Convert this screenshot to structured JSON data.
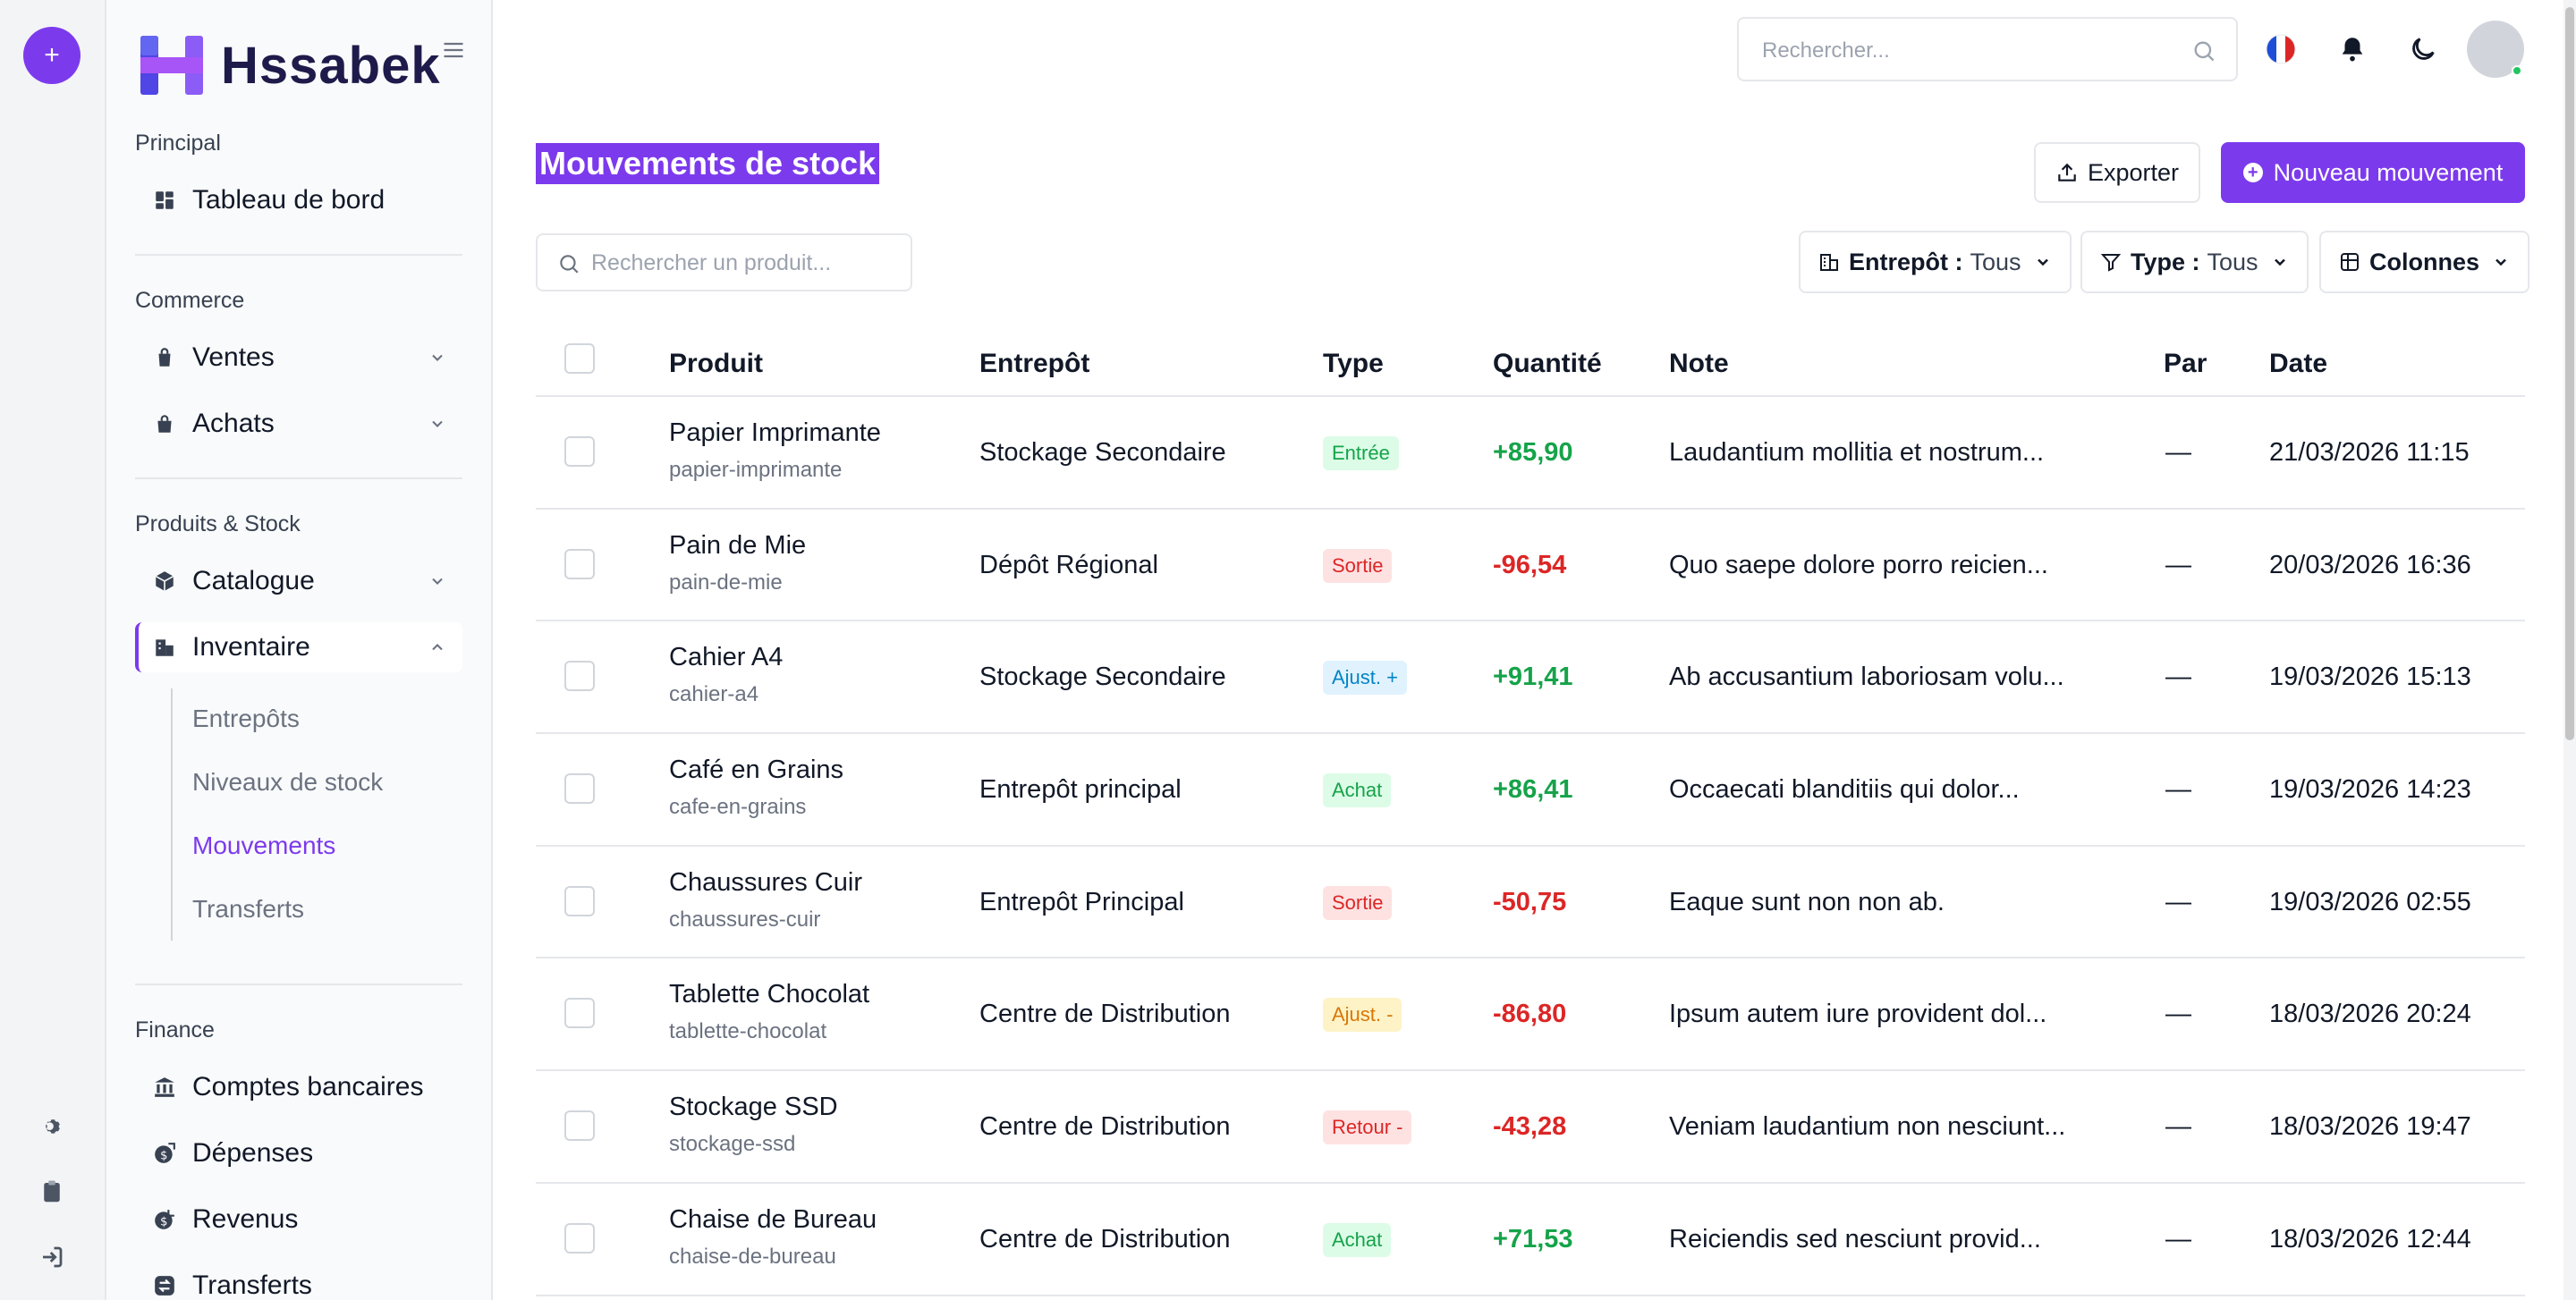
{
  "app": {
    "name": "Hssabek"
  },
  "sidebar": {
    "sections": {
      "principal": "Principal",
      "commerce": "Commerce",
      "produits": "Produits & Stock",
      "finance": "Finance"
    },
    "items": {
      "dashboard": "Tableau de bord",
      "ventes": "Ventes",
      "achats": "Achats",
      "catalogue": "Catalogue",
      "inventaire": "Inventaire",
      "comptes": "Comptes bancaires",
      "depenses": "Dépenses",
      "revenus": "Revenus",
      "transferts": "Transferts"
    },
    "sub_items": {
      "entrepots": "Entrepôts",
      "niveaux": "Niveaux de stock",
      "mouvements": "Mouvements",
      "transferts": "Transferts"
    }
  },
  "topbar": {
    "search_placeholder": "Rechercher..."
  },
  "page": {
    "title": "Mouvements de stock",
    "export_label": "Exporter",
    "new_label": "Nouveau mouvement"
  },
  "filters": {
    "search_placeholder": "Rechercher un produit...",
    "warehouse_label": "Entrepôt :",
    "warehouse_value": "Tous",
    "type_label": "Type :",
    "type_value": "Tous",
    "columns_label": "Colonnes"
  },
  "table": {
    "headers": {
      "produit": "Produit",
      "entrepot": "Entrepôt",
      "type": "Type",
      "quantite": "Quantité",
      "note": "Note",
      "par": "Par",
      "date": "Date"
    },
    "rows": [
      {
        "name": "Papier Imprimante",
        "slug": "papier-imprimante",
        "warehouse": "Stockage Secondaire",
        "type": "Entrée",
        "qty": "+85,90",
        "note": "Laudantium mollitia et nostrum...",
        "by": "—",
        "date": "21/03/2026 11:15"
      },
      {
        "name": "Pain de Mie",
        "slug": "pain-de-mie",
        "warehouse": "Dépôt Régional",
        "type": "Sortie",
        "qty": "-96,54",
        "note": "Quo saepe dolore porro reicien...",
        "by": "—",
        "date": "20/03/2026 16:36"
      },
      {
        "name": "Cahier A4",
        "slug": "cahier-a4",
        "warehouse": "Stockage Secondaire",
        "type": "Ajust. +",
        "qty": "+91,41",
        "note": "Ab accusantium laboriosam volu...",
        "by": "—",
        "date": "19/03/2026 15:13"
      },
      {
        "name": "Café en Grains",
        "slug": "cafe-en-grains",
        "warehouse": "Entrepôt principal",
        "type": "Achat",
        "qty": "+86,41",
        "note": "Occaecati blanditiis qui dolor...",
        "by": "—",
        "date": "19/03/2026 14:23"
      },
      {
        "name": "Chaussures Cuir",
        "slug": "chaussures-cuir",
        "warehouse": "Entrepôt Principal",
        "type": "Sortie",
        "qty": "-50,75",
        "note": "Eaque sunt non non ab.",
        "by": "—",
        "date": "19/03/2026 02:55"
      },
      {
        "name": "Tablette Chocolat",
        "slug": "tablette-chocolat",
        "warehouse": "Centre de Distribution",
        "type": "Ajust. -",
        "qty": "-86,80",
        "note": "Ipsum autem iure provident dol...",
        "by": "—",
        "date": "18/03/2026 20:24"
      },
      {
        "name": "Stockage SSD",
        "slug": "stockage-ssd",
        "warehouse": "Centre de Distribution",
        "type": "Retour -",
        "qty": "-43,28",
        "note": "Veniam laudantium non nesciunt...",
        "by": "—",
        "date": "18/03/2026 19:47"
      },
      {
        "name": "Chaise de Bureau",
        "slug": "chaise-de-bureau",
        "warehouse": "Centre de Distribution",
        "type": "Achat",
        "qty": "+71,53",
        "note": "Reiciendis sed nesciunt provid...",
        "by": "—",
        "date": "18/03/2026 12:44"
      }
    ]
  },
  "colors": {
    "accent": "#7c3aed",
    "positive": "#16a34a",
    "negative": "#dc2626",
    "entree_bg": "#dcfce7",
    "sortie_bg": "#fee2e2",
    "ajust_plus_bg": "#e0f2fe",
    "ajust_minus_bg": "#fef3c7"
  }
}
